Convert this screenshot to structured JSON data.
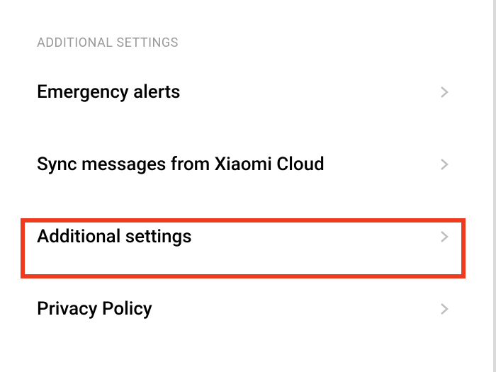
{
  "section": {
    "header": "ADDITIONAL SETTINGS"
  },
  "items": [
    {
      "label": "Emergency alerts"
    },
    {
      "label": "Sync messages from Xiaomi Cloud"
    },
    {
      "label": "Additional settings"
    },
    {
      "label": "Privacy Policy"
    }
  ]
}
